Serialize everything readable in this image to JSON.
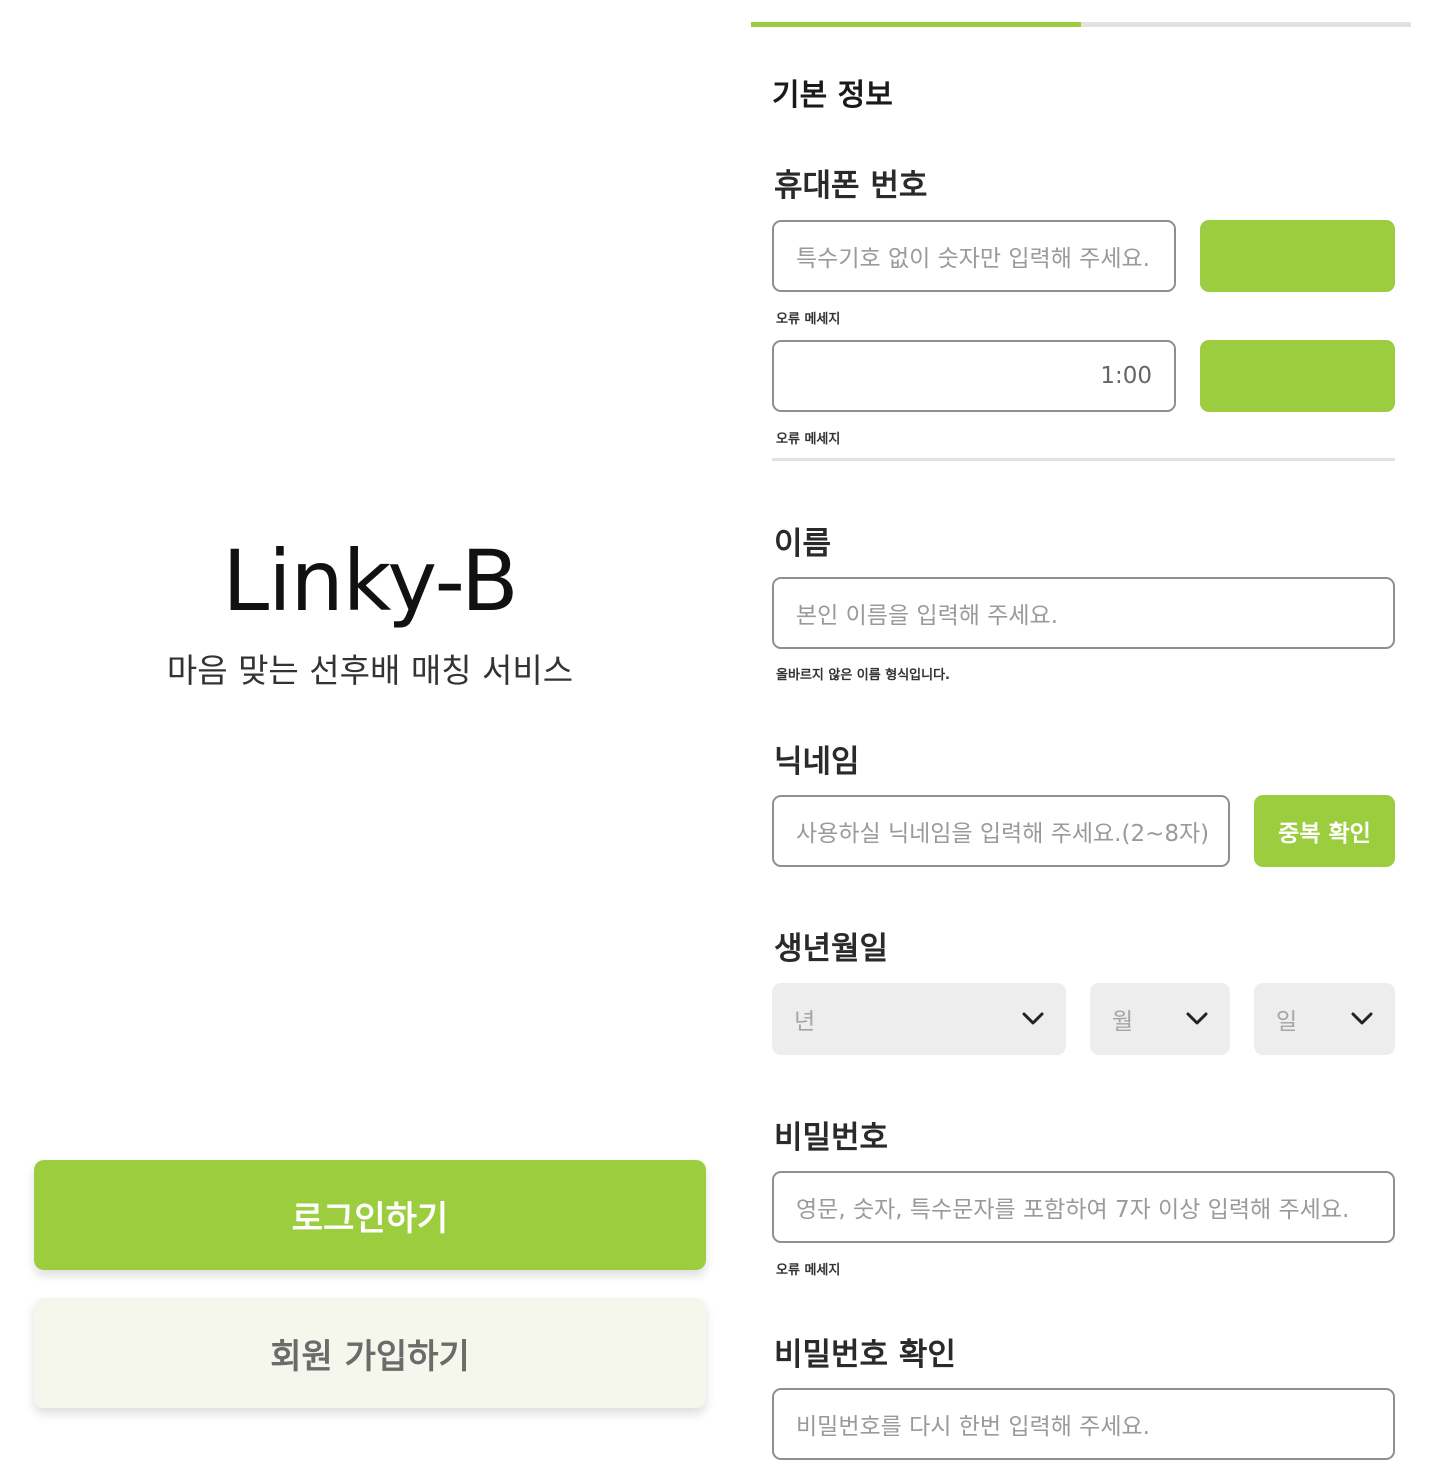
{
  "colors": {
    "accent": "#9bcd3f",
    "signup_bg": "#f6f7ec"
  },
  "landing": {
    "logo": "Linky-B",
    "tagline": "마음 맞는 선후배 매칭 서비스",
    "login_button": "로그인하기",
    "signup_button": "회원 가입하기"
  },
  "signup": {
    "progress": 0.5,
    "section_title": "기본 정보",
    "phone": {
      "label": "휴대폰 번호",
      "placeholder": "특수기호 없이 숫자만 입력해 주세요.",
      "error": "오류 메세지",
      "timer": "1:00",
      "code_error": "오류 메세지"
    },
    "name": {
      "label": "이름",
      "placeholder": "본인 이름을 입력해 주세요.",
      "error": "올바르지 않은 이름 형식입니다."
    },
    "nickname": {
      "label": "닉네임",
      "placeholder": "사용하실 닉네임을 입력해 주세요.(2~8자)",
      "check_button": "중복 확인"
    },
    "birth": {
      "label": "생년월일",
      "year": "년",
      "month": "월",
      "day": "일"
    },
    "password": {
      "label": "비밀번호",
      "placeholder": "영문, 숫자, 특수문자를 포함하여 7자 이상 입력해 주세요.",
      "error": "오류 메세지"
    },
    "password_confirm": {
      "label": "비밀번호 확인",
      "placeholder": "비밀번호를 다시 한번 입력해 주세요."
    }
  }
}
